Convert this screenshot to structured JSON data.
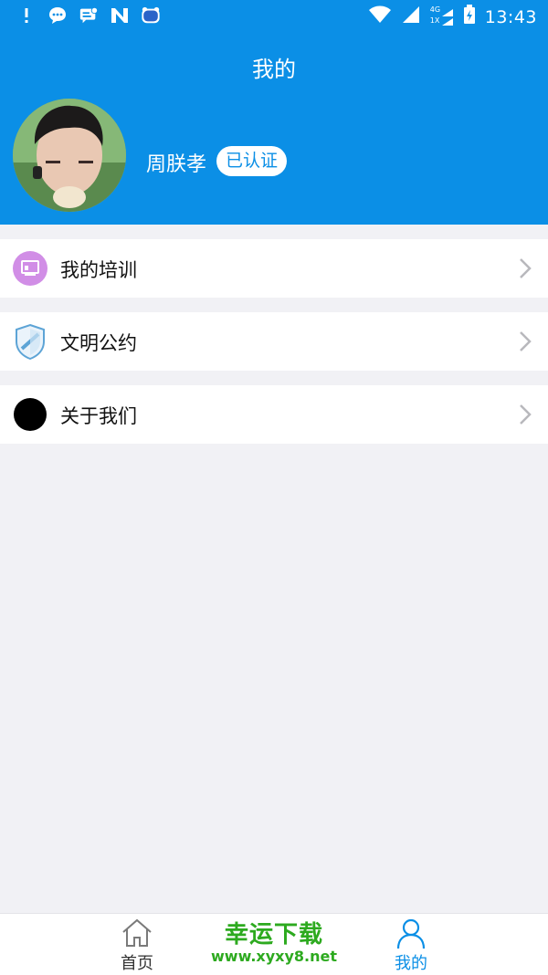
{
  "status_bar": {
    "time": "13:43",
    "network_label": "4G",
    "network_sub": "1X",
    "left_icons": [
      "alert-icon",
      "chat-bubble-icon",
      "message-icon",
      "n-app-icon",
      "du-app-icon"
    ],
    "du_label": "du"
  },
  "header": {
    "title": "我的"
  },
  "profile": {
    "name": "周朕孝",
    "badge": "已认证"
  },
  "menu": {
    "items": [
      {
        "label": "我的培训",
        "icon": "training-icon"
      },
      {
        "label": "文明公约",
        "icon": "shield-icon"
      },
      {
        "label": "关于我们",
        "icon": "about-dot-icon"
      }
    ]
  },
  "tab_bar": {
    "home_label": "首页",
    "mine_label": "我的",
    "active": "mine"
  },
  "watermark": {
    "title": "幸运下载",
    "url": "www.xyxy8.net"
  },
  "colors": {
    "brand_blue": "#0b8fe6",
    "background": "#f1f1f5",
    "watermark_green": "#2daa1f"
  }
}
